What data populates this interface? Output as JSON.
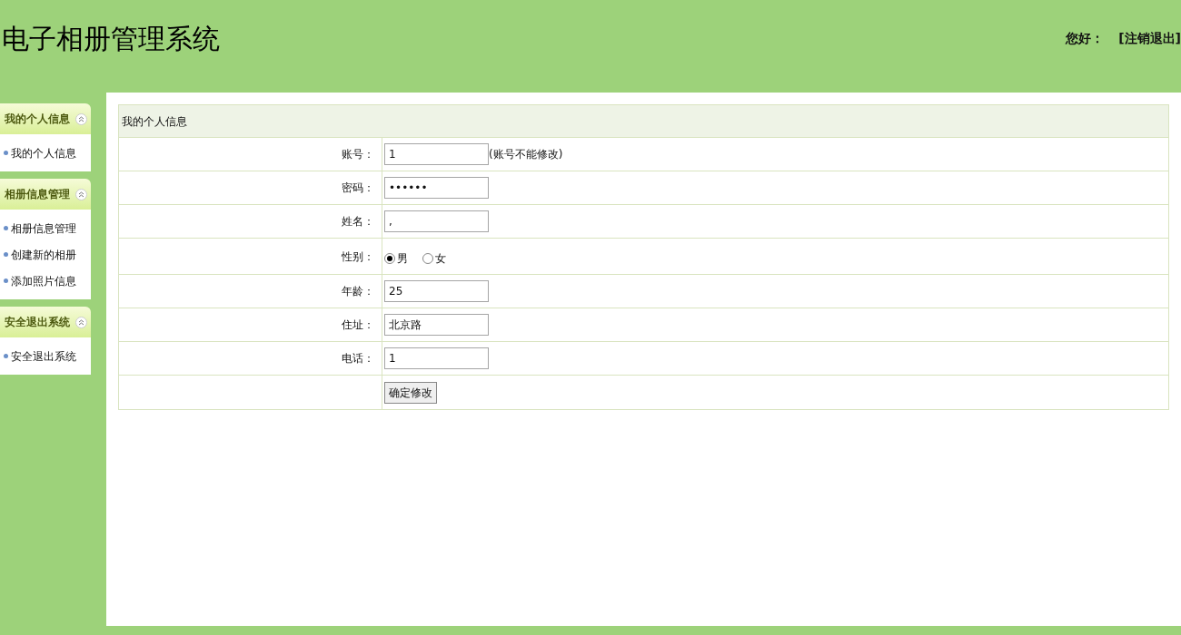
{
  "header": {
    "title": "电子相册管理系统",
    "greeting": "您好：",
    "logout": "[注销退出]"
  },
  "sidebar": [
    {
      "title": "我的个人信息",
      "items": [
        "我的个人信息"
      ]
    },
    {
      "title": "相册信息管理",
      "items": [
        "相册信息管理",
        "创建新的相册",
        "添加照片信息"
      ]
    },
    {
      "title": "安全退出系统",
      "items": [
        "安全退出系统"
      ]
    }
  ],
  "form": {
    "title": "我的个人信息",
    "rows": [
      {
        "kind": "text",
        "label": "账号：",
        "value": "1",
        "note": "(账号不能修改)"
      },
      {
        "kind": "text",
        "label": "密码：",
        "value": "••••••"
      },
      {
        "kind": "text",
        "label": "姓名：",
        "value": ","
      },
      {
        "kind": "radio",
        "label": "性别：",
        "options": [
          {
            "label": "男",
            "selected": true
          },
          {
            "label": "女",
            "selected": false
          }
        ]
      },
      {
        "kind": "text",
        "label": "年龄：",
        "value": "25"
      },
      {
        "kind": "text",
        "label": "住址：",
        "value": "北京路"
      },
      {
        "kind": "text",
        "label": "电话：",
        "value": "1"
      },
      {
        "kind": "button",
        "label": "",
        "button": "确定修改"
      }
    ]
  }
}
